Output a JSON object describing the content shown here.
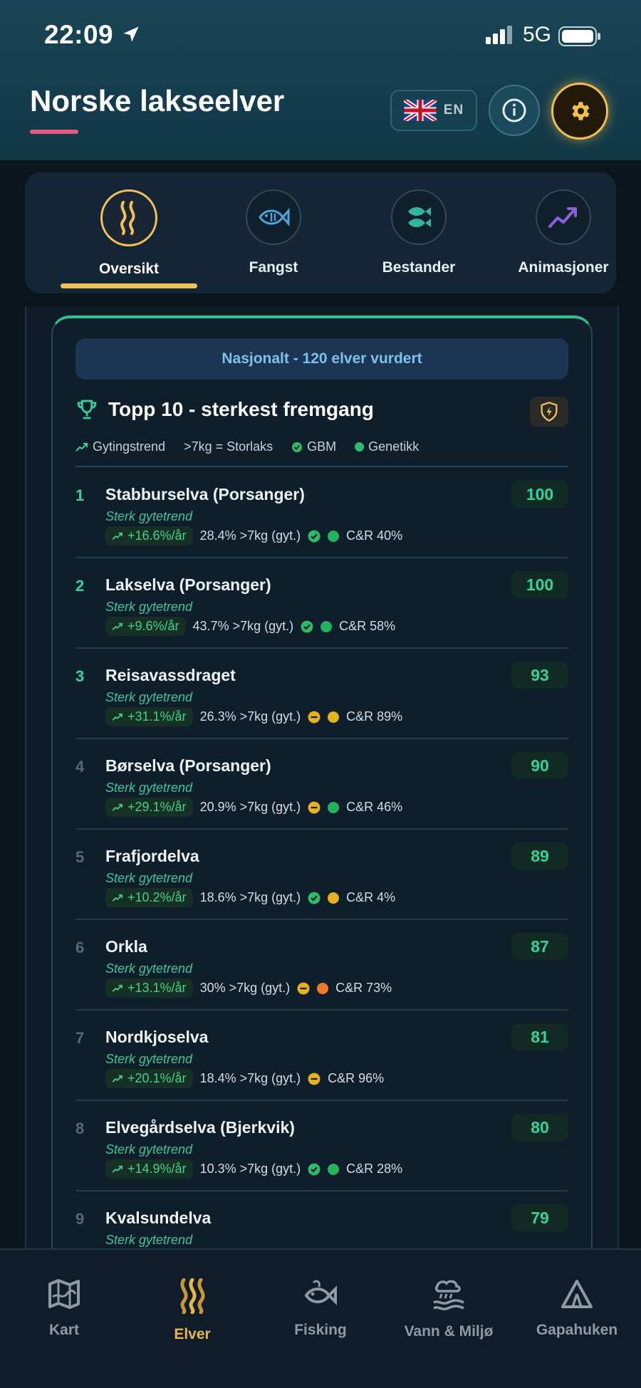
{
  "status_bar": {
    "time": "22:09",
    "network": "5G"
  },
  "header": {
    "title": "Norske lakseelver",
    "lang_label": "EN"
  },
  "tabs": [
    {
      "label": "Oversikt",
      "icon": "river-icon",
      "active": true
    },
    {
      "label": "Fangst",
      "icon": "fish-icon",
      "active": false
    },
    {
      "label": "Bestander",
      "icon": "fish-stock-icon",
      "active": false
    },
    {
      "label": "Animasjoner",
      "icon": "trend-up-icon",
      "active": false
    }
  ],
  "card": {
    "banner": "Nasjonalt - 120 elver vurdert",
    "title": "Topp 10 - sterkest fremgang",
    "legend": {
      "trend": "Gytingstrend",
      "storlaks": ">7kg = Storlaks",
      "gbm": "GBM",
      "genetikk": "Genetikk"
    }
  },
  "rivers": [
    {
      "rank": "1",
      "name": "Stabburselva (Porsanger)",
      "score": "100",
      "subtitle": "Sterk gytetrend",
      "trend": "+16.6%/år",
      "large": "28.4% >7kg (gyt.)",
      "gbm": "ok",
      "gen": "green",
      "cr": "C&R 40%"
    },
    {
      "rank": "2",
      "name": "Lakselva (Porsanger)",
      "score": "100",
      "subtitle": "Sterk gytetrend",
      "trend": "+9.6%/år",
      "large": "43.7% >7kg (gyt.)",
      "gbm": "ok",
      "gen": "green",
      "cr": "C&R 58%"
    },
    {
      "rank": "3",
      "name": "Reisavassdraget",
      "score": "93",
      "subtitle": "Sterk gytetrend",
      "trend": "+31.1%/år",
      "large": "26.3% >7kg (gyt.)",
      "gbm": "warn",
      "gen": "yellow",
      "cr": "C&R 89%"
    },
    {
      "rank": "4",
      "name": "Børselva (Porsanger)",
      "score": "90",
      "subtitle": "Sterk gytetrend",
      "trend": "+29.1%/år",
      "large": "20.9% >7kg (gyt.)",
      "gbm": "warn",
      "gen": "green",
      "cr": "C&R 46%"
    },
    {
      "rank": "5",
      "name": "Frafjordelva",
      "score": "89",
      "subtitle": "Sterk gytetrend",
      "trend": "+10.2%/år",
      "large": "18.6% >7kg (gyt.)",
      "gbm": "ok",
      "gen": "yellow",
      "cr": "C&R 4%"
    },
    {
      "rank": "6",
      "name": "Orkla",
      "score": "87",
      "subtitle": "Sterk gytetrend",
      "trend": "+13.1%/år",
      "large": "30% >7kg (gyt.)",
      "gbm": "warn",
      "gen": "orange",
      "cr": "C&R 73%"
    },
    {
      "rank": "7",
      "name": "Nordkjoselva",
      "score": "81",
      "subtitle": "Sterk gytetrend",
      "trend": "+20.1%/år",
      "large": "18.4% >7kg (gyt.)",
      "gbm": "warn",
      "gen": "none",
      "cr": "C&R 96%"
    },
    {
      "rank": "8",
      "name": "Elvegårdselva (Bjerkvik)",
      "score": "80",
      "subtitle": "Sterk gytetrend",
      "trend": "+14.9%/år",
      "large": "10.3% >7kg (gyt.)",
      "gbm": "ok",
      "gen": "green",
      "cr": "C&R 28%"
    },
    {
      "rank": "9",
      "name": "Kvalsundelva",
      "score": "79",
      "subtitle": "Sterk gytetrend",
      "trend": "",
      "large": "",
      "gbm": "none",
      "gen": "none",
      "cr": ""
    }
  ],
  "colors": {
    "ok": "#2dbb6a",
    "warn": "#e6b21f",
    "green": "#22b35e",
    "yellow": "#e6b21f",
    "orange": "#ef7a2a",
    "accent": "#f1c15b",
    "score_text": "#34d39c"
  },
  "bottom_nav": [
    {
      "label": "Kart",
      "icon": "map-icon",
      "active": false
    },
    {
      "label": "Elver",
      "icon": "river-icon",
      "active": true
    },
    {
      "label": "Fisking",
      "icon": "fish-icon",
      "active": false
    },
    {
      "label": "Vann & Miljø",
      "icon": "weather-water-icon",
      "active": false
    },
    {
      "label": "Gapahuken",
      "icon": "shelter-icon",
      "active": false
    }
  ]
}
